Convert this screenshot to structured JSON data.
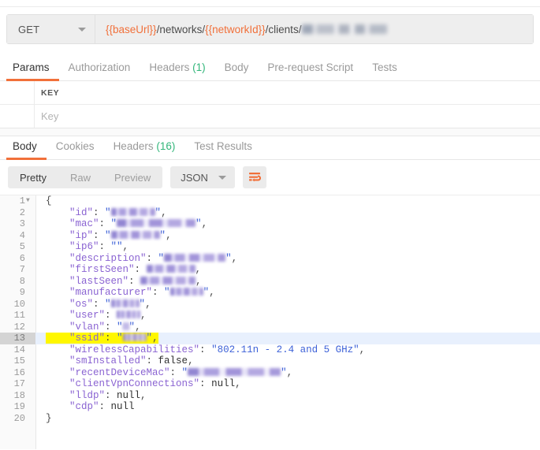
{
  "request": {
    "method": "GET",
    "method_caret_icon": "chevron-down-icon",
    "url": {
      "segments": [
        {
          "type": "var",
          "text": "{{baseUrl}}"
        },
        {
          "type": "text",
          "text": "/networks/"
        },
        {
          "type": "var",
          "text": "{{networkId}}"
        },
        {
          "type": "text",
          "text": "/clients/"
        },
        {
          "type": "redacted",
          "text": ""
        }
      ]
    },
    "tabs": [
      {
        "label": "Params",
        "active": true,
        "count": ""
      },
      {
        "label": "Authorization",
        "active": false,
        "count": ""
      },
      {
        "label": "Headers",
        "active": false,
        "count": "(1)"
      },
      {
        "label": "Body",
        "active": false,
        "count": ""
      },
      {
        "label": "Pre-request Script",
        "active": false,
        "count": ""
      },
      {
        "label": "Tests",
        "active": false,
        "count": ""
      }
    ],
    "params": {
      "header_key": "KEY",
      "placeholder_key": "Key"
    }
  },
  "response": {
    "tabs": [
      {
        "label": "Body",
        "active": true,
        "count": ""
      },
      {
        "label": "Cookies",
        "active": false,
        "count": ""
      },
      {
        "label": "Headers",
        "active": false,
        "count": "(16)"
      },
      {
        "label": "Test Results",
        "active": false,
        "count": ""
      }
    ],
    "format": {
      "modes": [
        {
          "label": "Pretty",
          "active": true
        },
        {
          "label": "Raw",
          "active": false
        },
        {
          "label": "Preview",
          "active": false
        }
      ],
      "language": "JSON",
      "language_caret_icon": "chevron-down-icon",
      "wrap_icon": "word-wrap-icon",
      "wrap_icon_color": "#f1703a"
    },
    "body": {
      "language": "json",
      "highlight_color": "#fff700",
      "active_line": 13,
      "lines": [
        {
          "n": 1,
          "fold": true,
          "tokens": [
            {
              "t": "p",
              "v": "{"
            }
          ]
        },
        {
          "n": 2,
          "tokens": [
            {
              "t": "k",
              "v": "    \"id\""
            },
            {
              "t": "p",
              "v": ": "
            },
            {
              "t": "s",
              "v": "\""
            },
            {
              "t": "blur",
              "v": "w56"
            },
            {
              "t": "s",
              "v": "\""
            },
            {
              "t": "p",
              "v": ","
            }
          ]
        },
        {
          "n": 3,
          "tokens": [
            {
              "t": "k",
              "v": "    \"mac\""
            },
            {
              "t": "p",
              "v": ": "
            },
            {
              "t": "s",
              "v": "\""
            },
            {
              "t": "blur",
              "v": "w100"
            },
            {
              "t": "s",
              "v": "\""
            },
            {
              "t": "p",
              "v": ","
            }
          ]
        },
        {
          "n": 4,
          "tokens": [
            {
              "t": "k",
              "v": "    \"ip\""
            },
            {
              "t": "p",
              "v": ": "
            },
            {
              "t": "s",
              "v": "\""
            },
            {
              "t": "blur",
              "v": "w62"
            },
            {
              "t": "s",
              "v": "\""
            },
            {
              "t": "p",
              "v": ","
            }
          ]
        },
        {
          "n": 5,
          "tokens": [
            {
              "t": "k",
              "v": "    \"ip6\""
            },
            {
              "t": "p",
              "v": ": "
            },
            {
              "t": "s",
              "v": "\"\""
            },
            {
              "t": "p",
              "v": ","
            }
          ]
        },
        {
          "n": 6,
          "tokens": [
            {
              "t": "k",
              "v": "    \"description\""
            },
            {
              "t": "p",
              "v": ": "
            },
            {
              "t": "s",
              "v": "\""
            },
            {
              "t": "blur",
              "v": "w78"
            },
            {
              "t": "s",
              "v": "\""
            },
            {
              "t": "p",
              "v": ","
            }
          ]
        },
        {
          "n": 7,
          "tokens": [
            {
              "t": "k",
              "v": "    \"firstSeen\""
            },
            {
              "t": "p",
              "v": ": "
            },
            {
              "t": "blur",
              "v": "w62"
            },
            {
              "t": "p",
              "v": ","
            }
          ]
        },
        {
          "n": 8,
          "tokens": [
            {
              "t": "k",
              "v": "    \"lastSeen\""
            },
            {
              "t": "p",
              "v": ": "
            },
            {
              "t": "blur",
              "v": "w70"
            },
            {
              "t": "p",
              "v": ","
            }
          ]
        },
        {
          "n": 9,
          "tokens": [
            {
              "t": "k",
              "v": "    \"manufacturer\""
            },
            {
              "t": "p",
              "v": ": "
            },
            {
              "t": "s",
              "v": "\""
            },
            {
              "t": "blur",
              "v": "w42"
            },
            {
              "t": "s",
              "v": "\""
            },
            {
              "t": "p",
              "v": ","
            }
          ]
        },
        {
          "n": 10,
          "tokens": [
            {
              "t": "k",
              "v": "    \"os\""
            },
            {
              "t": "p",
              "v": ": "
            },
            {
              "t": "s",
              "v": "\""
            },
            {
              "t": "blur",
              "v": "w36"
            },
            {
              "t": "s",
              "v": "\""
            },
            {
              "t": "p",
              "v": ","
            }
          ]
        },
        {
          "n": 11,
          "tokens": [
            {
              "t": "k",
              "v": "    \"user\""
            },
            {
              "t": "p",
              "v": ": "
            },
            {
              "t": "blur",
              "v": "w30"
            },
            {
              "t": "p",
              "v": ","
            }
          ]
        },
        {
          "n": 12,
          "tokens": [
            {
              "t": "k",
              "v": "    \"vlan\""
            },
            {
              "t": "p",
              "v": ": "
            },
            {
              "t": "s",
              "v": "\""
            },
            {
              "t": "blur",
              "v": "w8"
            },
            {
              "t": "s",
              "v": "\""
            },
            {
              "t": "p",
              "v": ","
            }
          ]
        },
        {
          "n": 13,
          "highlight": true,
          "tokens": [
            {
              "t": "k",
              "v": "    \"ssid\""
            },
            {
              "t": "p",
              "v": ": "
            },
            {
              "t": "s",
              "v": "\""
            },
            {
              "t": "blur",
              "v": "w30"
            },
            {
              "t": "s",
              "v": "\""
            },
            {
              "t": "p",
              "v": ","
            }
          ]
        },
        {
          "n": 14,
          "tokens": [
            {
              "t": "k",
              "v": "    \"wirelessCapabilities\""
            },
            {
              "t": "p",
              "v": ": "
            },
            {
              "t": "s",
              "v": "\"802.11n - 2.4 and 5 GHz\""
            },
            {
              "t": "p",
              "v": ","
            }
          ]
        },
        {
          "n": 15,
          "tokens": [
            {
              "t": "k",
              "v": "    \"smInstalled\""
            },
            {
              "t": "p",
              "v": ": "
            },
            {
              "t": "lit",
              "v": "false"
            },
            {
              "t": "p",
              "v": ","
            }
          ]
        },
        {
          "n": 16,
          "tokens": [
            {
              "t": "k",
              "v": "    \"recentDeviceMac\""
            },
            {
              "t": "p",
              "v": ": "
            },
            {
              "t": "s",
              "v": "\""
            },
            {
              "t": "blur",
              "v": "w118"
            },
            {
              "t": "s",
              "v": "\""
            },
            {
              "t": "p",
              "v": ","
            }
          ]
        },
        {
          "n": 17,
          "tokens": [
            {
              "t": "k",
              "v": "    \"clientVpnConnections\""
            },
            {
              "t": "p",
              "v": ": "
            },
            {
              "t": "lit",
              "v": "null"
            },
            {
              "t": "p",
              "v": ","
            }
          ]
        },
        {
          "n": 18,
          "tokens": [
            {
              "t": "k",
              "v": "    \"lldp\""
            },
            {
              "t": "p",
              "v": ": "
            },
            {
              "t": "lit",
              "v": "null"
            },
            {
              "t": "p",
              "v": ","
            }
          ]
        },
        {
          "n": 19,
          "tokens": [
            {
              "t": "k",
              "v": "    \"cdp\""
            },
            {
              "t": "p",
              "v": ": "
            },
            {
              "t": "lit",
              "v": "null"
            }
          ]
        },
        {
          "n": 20,
          "tokens": [
            {
              "t": "p",
              "v": "}"
            }
          ]
        }
      ]
    }
  },
  "theme": {
    "accent": "#f1703a",
    "count_green": "#32b67a",
    "json_key": "#8a63d2",
    "json_string": "#3e62d8",
    "active_line_bg": "#e8f0fd"
  }
}
